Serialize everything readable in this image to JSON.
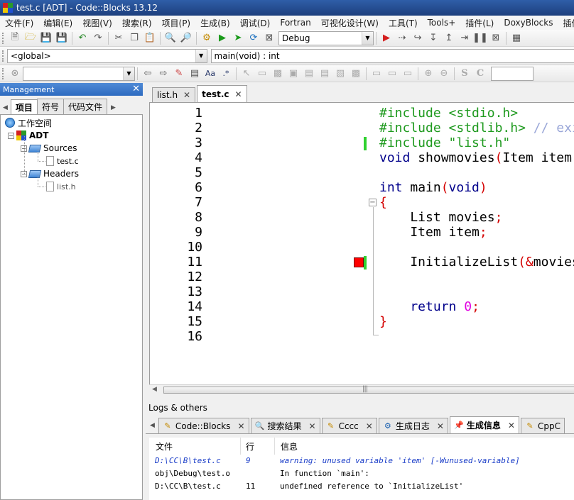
{
  "window": {
    "title": "test.c [ADT] - Code::Blocks 13.12"
  },
  "menu": [
    "文件(F)",
    "编辑(E)",
    "视图(V)",
    "搜索(R)",
    "项目(P)",
    "生成(B)",
    "调试(D)",
    "Fortran",
    "可视化设计(W)",
    "工具(T)",
    "Tools+",
    "插件(L)",
    "DoxyBlocks",
    "插件(P)"
  ],
  "toolbar": {
    "build_target": "Debug",
    "scope": "<global>",
    "function": "main(void) : int",
    "search_value": ""
  },
  "management": {
    "title": "Management",
    "tabs": [
      "项目",
      "符号",
      "代码文件"
    ],
    "tree": {
      "workspace": "工作空间",
      "project": "ADT",
      "sources_folder": "Sources",
      "source_file": "test.c",
      "headers_folder": "Headers",
      "header_file": "list.h"
    }
  },
  "editor": {
    "tabs": [
      "list.h",
      "test.c"
    ],
    "active_tab": "test.c",
    "line_numbers": [
      "1",
      "2",
      "3",
      "4",
      "5",
      "6",
      "7",
      "8",
      "9",
      "10",
      "11",
      "12",
      "13",
      "14",
      "15",
      "16"
    ],
    "code": {
      "l1": {
        "a": "#include ",
        "b": "<stdio.h>"
      },
      "l2": {
        "a": "#include ",
        "b": "<stdlib.h>",
        "c": " // exit()"
      },
      "l3": {
        "a": "#include ",
        "b": "\"list.h\""
      },
      "l4": {
        "a": "void",
        "b": " showmovies",
        "c": "(",
        "d": "Item item",
        "e": ");"
      },
      "l6": {
        "a": "int",
        "b": " main",
        "c": "(",
        "d": "void",
        "e": ")"
      },
      "l7": {
        "a": "{"
      },
      "l8": {
        "a": "    List movies",
        "b": ";"
      },
      "l9": {
        "a": "    Item item",
        "b": ";"
      },
      "l11": {
        "a": "    InitializeList",
        "b": "(&",
        "c": "movies",
        "d": ");"
      },
      "l14": {
        "a": "    return",
        "b": " 0",
        "c": ";"
      },
      "l15": {
        "a": "}"
      }
    }
  },
  "logs": {
    "title": "Logs & others",
    "tabs": [
      "Code::Blocks",
      "搜索结果",
      "Cccc",
      "生成日志",
      "生成信息",
      "CppC"
    ],
    "active_tab": "生成信息",
    "headers": {
      "file": "文件",
      "line": "行",
      "message": "信息"
    },
    "rows": [
      {
        "file": "D:\\CC\\B\\test.c",
        "line": "9",
        "message": "warning: unused variable 'item' [-Wunused-variable]"
      },
      {
        "file": "obj\\Debug\\test.o",
        "line": "",
        "message": "In function `main':"
      },
      {
        "file": "D:\\CC\\B\\test.c",
        "line": "11",
        "message": "undefined reference to `InitializeList'"
      }
    ]
  }
}
